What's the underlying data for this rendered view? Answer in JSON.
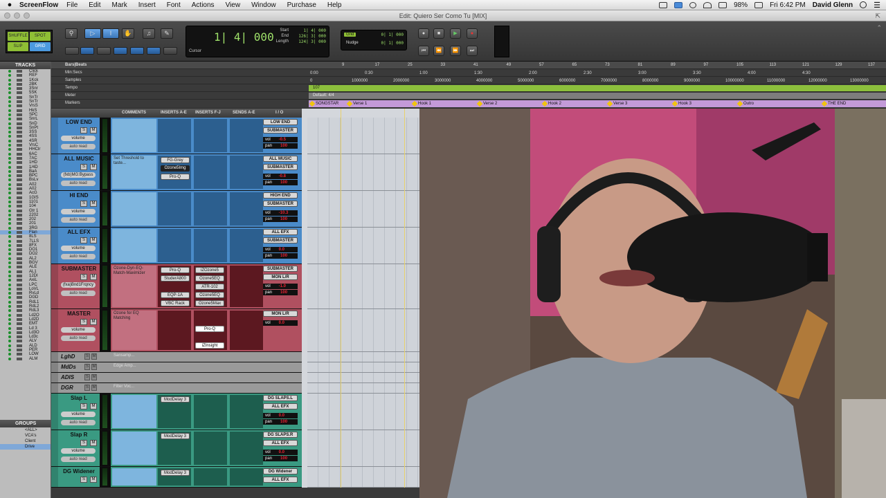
{
  "menubar": {
    "app": "ScreenFlow",
    "items": [
      "File",
      "Edit",
      "Mark",
      "Insert",
      "Font",
      "Actions",
      "View",
      "Window",
      "Purchase",
      "Help"
    ],
    "battery": "98%",
    "clock": "Fri 6:42 PM",
    "user": "David Glenn"
  },
  "window": {
    "title": "Edit: Quiero Ser Como Tu [MIX]"
  },
  "toolbar": {
    "modes": [
      "SHUFFLE",
      "SPOT",
      "SLIP",
      "GRID"
    ],
    "counter": {
      "main": "1| 4| 000",
      "start_label": "Start",
      "end_label": "End",
      "length_label": "Length",
      "start": "1| 4| 000",
      "end": "126| 3| 000",
      "length": "124| 3| 000",
      "cursor_label": "Cursor"
    },
    "grid": {
      "grid_label": "Grid",
      "nudge_label": "Nudge",
      "grid_value": "0| 1| 000",
      "nudge_value": "0| 1| 000"
    }
  },
  "tracks": {
    "header": "TRACKS",
    "items": [
      "Click",
      "REF",
      "1Kck",
      "2BK",
      "3Snr",
      "5SK",
      "SnTr",
      "SnTr",
      "VrsS",
      "HkS",
      "SPC",
      "SnrL",
      "SnD",
      "SnPt",
      "3SS",
      "4SS",
      "4SR",
      "VrsC",
      "HHClr",
      "6AC",
      "7AC",
      "1HD",
      "1/4D",
      "BaA",
      "BPC",
      "BsLv",
      "A02",
      "A02",
      "AcG",
      "1GIS",
      "1101",
      "104",
      "Gtr 1",
      "2202",
      "202",
      "201",
      "3RG",
      "Flan",
      "8LS",
      "7LLS",
      "8FX",
      "DO1",
      "DO2",
      "AL2",
      "BGV",
      "ALE",
      "AL1",
      "12DI",
      "AxiL",
      "LPC",
      "LoVL",
      "RvLd",
      "DGD",
      "RdL1",
      "RdL2",
      "RdL3",
      "Ld2O",
      "Ld2D",
      "EMT",
      "Ld 3",
      "Ld3O",
      "Ld3c",
      "ALV",
      "ALD",
      "PER",
      "LOW",
      "ALM"
    ],
    "highlighted_index": 37
  },
  "groups": {
    "header": "GROUPS",
    "items": [
      "<ALL>",
      "VCA's",
      "Client",
      "Drive"
    ]
  },
  "rulers": {
    "labels": [
      "Bars|Beats",
      "Min:Secs",
      "Samples",
      "Tempo",
      "Meter",
      "Markers"
    ],
    "bars": [
      "9",
      "17",
      "25",
      "33",
      "41",
      "49",
      "57",
      "65",
      "73",
      "81",
      "89",
      "97",
      "105",
      "113",
      "121",
      "129",
      "137"
    ],
    "minsecs": [
      "0:00",
      "0:30",
      "1:00",
      "1:30",
      "2:00",
      "2:30",
      "3:00",
      "3:30",
      "4:00",
      "4:30"
    ],
    "samples": [
      "0",
      "1000000",
      "2000000",
      "3000000",
      "4000000",
      "5000000",
      "6000000",
      "7000000",
      "8000000",
      "9000000",
      "10000000",
      "11000000",
      "12000000",
      "13000000"
    ],
    "tempo": "107",
    "meter": "Default: 4/4",
    "markers": [
      "SONGSTAR",
      "Verse 1",
      "Hook 1",
      "Verse 2",
      "Hook 2",
      "Verse 3",
      "Hook 3",
      "Outro",
      "THE END"
    ]
  },
  "columns": [
    "COMMENTS",
    "INSERTS A-E",
    "INSERTS F-J",
    "SENDS A-E",
    "I / O"
  ],
  "strips": [
    {
      "name": "LOW END",
      "color": "#4a8bc9",
      "comment": "",
      "ins_ae": [],
      "ins_fj": [],
      "io": [
        "LOW END",
        "SUBMASTER"
      ],
      "vol": "-0.5",
      "pan": "100",
      "dd": "volume",
      "ar": "auto read"
    },
    {
      "name": "ALL MUSIC",
      "color": "#4a8bc9",
      "comment": "Set Threshold to taste...",
      "ins_ae": [
        "FG-Grey",
        "Ozone5Img",
        "Pro-Q"
      ],
      "ins_fj": [],
      "io": [
        "ALL MUSIC",
        "SUBMASTER"
      ],
      "vol": "-0.8",
      "pan": "100",
      "dd": "(fxb)MG:Bypass",
      "ar": "auto read"
    },
    {
      "name": "HI END",
      "color": "#4a8bc9",
      "comment": "",
      "ins_ae": [],
      "ins_fj": [],
      "io": [
        "HIGH END",
        "SUBMASTER"
      ],
      "vol": "-10.3",
      "pan": "100",
      "dd": "volume",
      "ar": "auto read"
    },
    {
      "name": "ALL EFX",
      "color": "#4a8bc9",
      "comment": "",
      "ins_ae": [],
      "ins_fj": [],
      "io": [
        "ALL EFX",
        "SUBMASTER"
      ],
      "vol": "0.0",
      "pan": "100",
      "dd": "volume",
      "ar": "auto read"
    },
    {
      "name": "SUBMASTER",
      "color": "#b05060",
      "comment": "Ozone-Dyn-EQ-Match-Maximizer",
      "ins_ae": [
        "Pro-Q",
        "StuderA800",
        "",
        "EQP-1A",
        "VBC Rack"
      ],
      "ins_fj": [
        "iZOzone5",
        "Ozone5EQ",
        "ATR-102",
        "Ozone5EQ",
        "Ozone5Max"
      ],
      "io": [
        "SUBMASTER",
        "MON L/R"
      ],
      "vol": "-1.0",
      "pan": "100",
      "dd": "(fxa)Bnd1Frqncy",
      "ar": "auto read"
    },
    {
      "name": "MASTER",
      "color": "#b05060",
      "comment": "Ozone for EQ Matching",
      "ins_ae": [],
      "ins_fj": [
        "Pro-Q",
        "iZInsight"
      ],
      "io": [
        "MON L/R"
      ],
      "vol": "0.0",
      "pan": "",
      "dd": "volume",
      "ar": "auto read"
    },
    {
      "name": "LghD",
      "color": "#9a9a9a",
      "comment": "Sansamp...",
      "inactive": true
    },
    {
      "name": "MdDs",
      "color": "#9a9a9a",
      "comment": "Edge Amp...",
      "inactive": true
    },
    {
      "name": "ADIS",
      "color": "#9a9a9a",
      "comment": "",
      "inactive": true
    },
    {
      "name": "DGR",
      "color": "#9a9a9a",
      "comment": "Filter Voc...",
      "inactive": true
    },
    {
      "name": "Slap L",
      "color": "#3a9a82",
      "comment": "",
      "ins_ae": [
        "ModDelay 3"
      ],
      "ins_fj": [],
      "io": [
        "DG SLAPS.L",
        "ALL EFX"
      ],
      "vol": "0.0",
      "pan": "100",
      "dd": "volume",
      "ar": "auto read"
    },
    {
      "name": "Slap R",
      "color": "#3a9a82",
      "comment": "",
      "ins_ae": [
        "ModDelay 3"
      ],
      "ins_fj": [],
      "io": [
        "DG SLAPS.R",
        "ALL EFX"
      ],
      "vol": "0.0",
      "pan": "100",
      "dd": "volume",
      "ar": "auto read"
    },
    {
      "name": "DG Widener",
      "color": "#3a9a82",
      "comment": "",
      "ins_ae": [
        "ModDelay 3"
      ],
      "ins_fj": [],
      "io": [
        "DG Widener",
        "ALL EFX"
      ],
      "vol": "",
      "pan": "",
      "dd": "",
      "ar": ""
    }
  ],
  "labels": {
    "vol": "vol",
    "pan": "pan",
    "s": "S",
    "m": "M"
  },
  "colors": {
    "counter_green": "#9fe26a",
    "selection_blue": "#4c9ae0",
    "mode_green": "#8fbf35",
    "marker_yellow": "#f1c40f"
  }
}
